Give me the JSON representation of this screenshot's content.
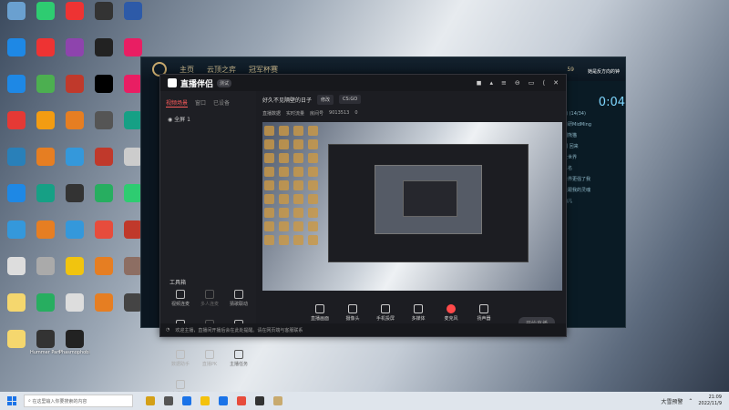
{
  "desktop": {
    "icons": [
      {
        "label": "",
        "color": "#6aa0d0"
      },
      {
        "label": "",
        "color": "#2ecc71"
      },
      {
        "label": "",
        "color": "#e33"
      },
      {
        "label": "",
        "color": "#333"
      },
      {
        "label": "",
        "color": "#2d5aa8"
      },
      {
        "label": "",
        "color": "#1e88e5"
      },
      {
        "label": "",
        "color": "#e33"
      },
      {
        "label": "",
        "color": "#8e44ad"
      },
      {
        "label": "",
        "color": "#222"
      },
      {
        "label": "",
        "color": "#e91e63"
      },
      {
        "label": "",
        "color": "#1e88e5"
      },
      {
        "label": "",
        "color": "#4caf50"
      },
      {
        "label": "",
        "color": "#c0392b"
      },
      {
        "label": "",
        "color": "#000"
      },
      {
        "label": "",
        "color": "#e91e63"
      },
      {
        "label": "",
        "color": "#e53935"
      },
      {
        "label": "",
        "color": "#f39c12"
      },
      {
        "label": "",
        "color": "#e67e22"
      },
      {
        "label": "",
        "color": "#555"
      },
      {
        "label": "",
        "color": "#16a085"
      },
      {
        "label": "",
        "color": "#2980b9"
      },
      {
        "label": "",
        "color": "#e67e22"
      },
      {
        "label": "",
        "color": "#3498db"
      },
      {
        "label": "",
        "color": "#c0392b"
      },
      {
        "label": "",
        "color": "#ccc"
      },
      {
        "label": "",
        "color": "#1e88e5"
      },
      {
        "label": "",
        "color": "#16a085"
      },
      {
        "label": "",
        "color": "#333"
      },
      {
        "label": "",
        "color": "#27ae60"
      },
      {
        "label": "",
        "color": "#2ecc71"
      },
      {
        "label": "",
        "color": "#3498db"
      },
      {
        "label": "",
        "color": "#e67e22"
      },
      {
        "label": "",
        "color": "#3498db"
      },
      {
        "label": "",
        "color": "#e74c3c"
      },
      {
        "label": "",
        "color": "#c0392b"
      },
      {
        "label": "",
        "color": "#ddd"
      },
      {
        "label": "",
        "color": "#aaa"
      },
      {
        "label": "",
        "color": "#f1c40f"
      },
      {
        "label": "",
        "color": "#e67e22"
      },
      {
        "label": "",
        "color": "#8d6e63"
      },
      {
        "label": "",
        "color": "#f5d76e"
      },
      {
        "label": "",
        "color": "#27ae60"
      },
      {
        "label": "",
        "color": "#ddd"
      },
      {
        "label": "",
        "color": "#e67e22"
      },
      {
        "label": "",
        "color": "#444"
      },
      {
        "label": "",
        "color": "#f5d76e"
      },
      {
        "label": "Hummer Party",
        "color": "#333"
      },
      {
        "label": "Phasmophobia",
        "color": "#222"
      }
    ]
  },
  "lol": {
    "tabs": [
      "主页",
      "云顶之弈",
      "冠军杯赛"
    ],
    "currency": "59",
    "username": "她是反方向的钟",
    "clock_partial": "0:04",
    "chat_lines": [
      "的 (14/34)",
      "日研MidMing",
      "团熊猫",
      "团 回来",
      "大世界",
      "人名",
      "世界更强了我",
      "长跟我的灵魂",
      "向儿"
    ]
  },
  "app": {
    "brand": "直播伴侣",
    "version": "测试",
    "window_controls": [
      "◼",
      "▴",
      "≡",
      "⊖",
      "▭",
      "⟨",
      "✕"
    ],
    "sidebar_tabs": [
      "视频场景",
      "窗口",
      "已设备"
    ],
    "scene_name": "全屏 1",
    "tools_title": "工具箱",
    "tools": [
      {
        "label": "视频连麦",
        "dim": false
      },
      {
        "label": "多人连麦",
        "dim": true
      },
      {
        "label": "猜歌联动",
        "dim": false
      },
      {
        "label": "游戏答题",
        "dim": false
      },
      {
        "label": "直播PK",
        "dim": true
      },
      {
        "label": "语音房",
        "dim": false
      },
      {
        "label": "数据助手",
        "dim": false
      },
      {
        "label": "直播PK",
        "dim": false
      },
      {
        "label": "主播任务",
        "dim": true
      },
      {
        "label": "直播助手",
        "dim": false
      }
    ],
    "live_title": "好久不见隔壁的日子",
    "live_tag": "修改",
    "live_category": "CS:GO",
    "meta": [
      "直播数据",
      "实时流量",
      "房间号",
      "9013513",
      "0"
    ],
    "controls": [
      {
        "label": "直播画面",
        "red": false
      },
      {
        "label": "摄像头",
        "red": false
      },
      {
        "label": "手机投屏",
        "red": false
      },
      {
        "label": "多媒体",
        "red": false
      },
      {
        "label": "麦克风",
        "red": true
      },
      {
        "label": "扬声器",
        "red": false
      }
    ],
    "start_live": "开始直播",
    "status": "欢迎主播，直播间开播后会在此处提醒。请在网页端与客服联系"
  },
  "taskbar": {
    "search_placeholder": "在这里输入你要搜索的内容",
    "time": "21:09",
    "date": "2022/11/9",
    "tray_text": "大雪预警"
  }
}
